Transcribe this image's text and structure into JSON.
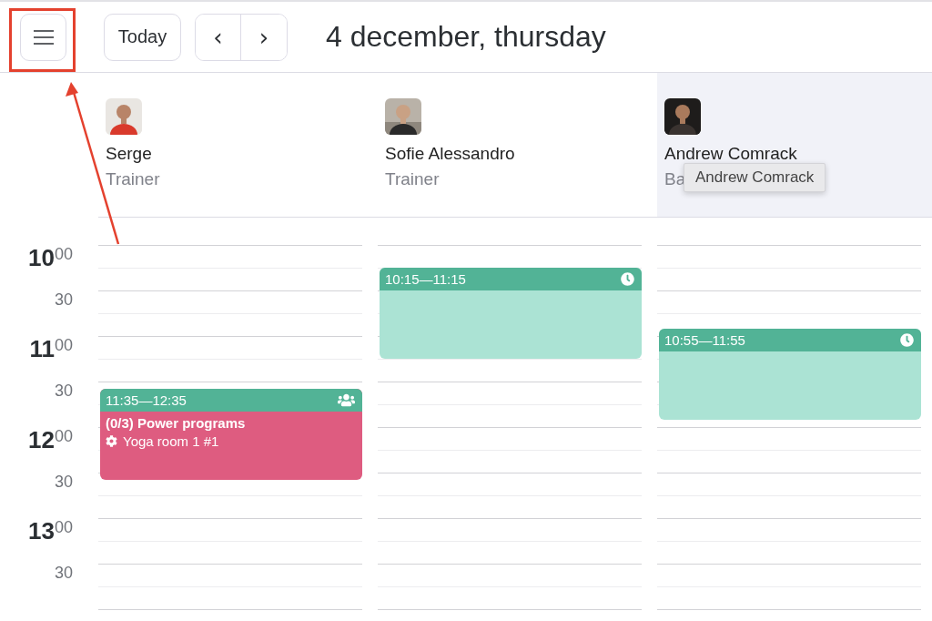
{
  "toolbar": {
    "today_button": "Today",
    "prev_button": "‹",
    "next_button": "›",
    "date_title": "4 december, thursday"
  },
  "time_labels": [
    {
      "hour": "10",
      "minutes": "00"
    },
    {
      "minutes": "30"
    },
    {
      "hour": "11",
      "minutes": "00"
    },
    {
      "minutes": "30"
    },
    {
      "hour": "12",
      "minutes": "00"
    },
    {
      "minutes": "30"
    },
    {
      "hour": "13",
      "minutes": "00"
    },
    {
      "minutes": "30"
    }
  ],
  "resources": [
    {
      "name": "Serge",
      "role": "Trainer",
      "highlighted": false,
      "events": [
        {
          "kind": "group",
          "time": "11:35—12:35",
          "color": "#de5c80",
          "title": "(0/3) Power programs",
          "room": "Yoga room 1 #1"
        }
      ]
    },
    {
      "name": "Sofie Alessandro",
      "role": "Trainer",
      "highlighted": false,
      "events": [
        {
          "kind": "single",
          "time": "10:15—11:15",
          "color": "#abe3d4"
        }
      ]
    },
    {
      "name": "Andrew Comrack",
      "role": "Ba",
      "highlighted": true,
      "tooltip": "Andrew Comrack",
      "events": [
        {
          "kind": "single",
          "time": "10:55—11:55",
          "color": "#abe3d4"
        }
      ]
    }
  ]
}
